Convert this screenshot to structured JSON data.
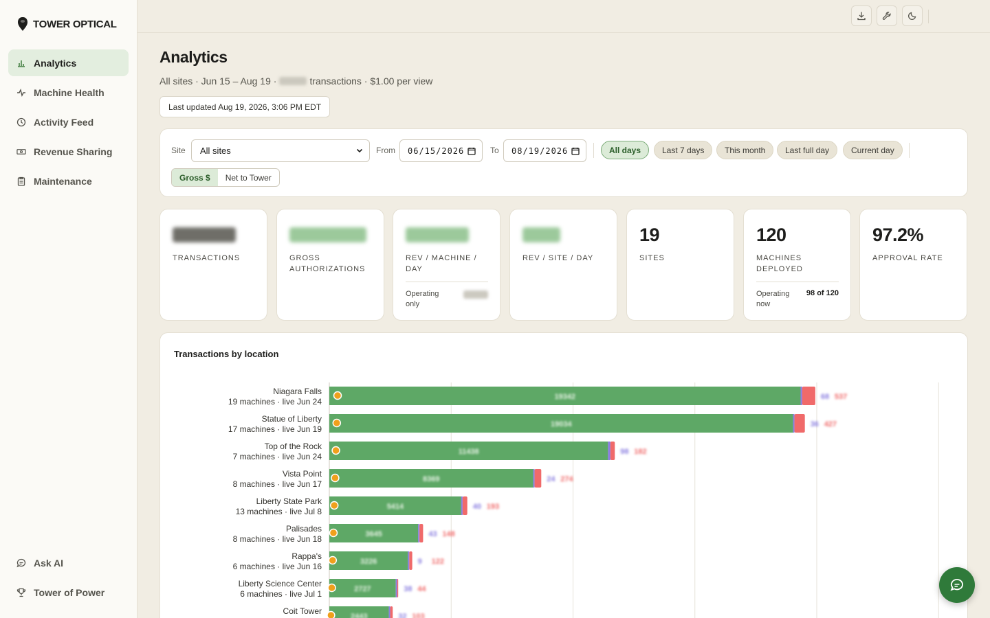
{
  "brand": {
    "name": "TOWER OPTICAL"
  },
  "nav": {
    "items": [
      {
        "label": "Analytics",
        "icon": "bar-chart-icon"
      },
      {
        "label": "Machine Health",
        "icon": "pulse-icon"
      },
      {
        "label": "Activity Feed",
        "icon": "clock-icon"
      },
      {
        "label": "Revenue Sharing",
        "icon": "cash-icon"
      },
      {
        "label": "Maintenance",
        "icon": "clipboard-icon"
      }
    ],
    "bottom": [
      {
        "label": "Ask AI",
        "icon": "chat-icon"
      },
      {
        "label": "Tower of Power",
        "icon": "trophy-icon"
      }
    ]
  },
  "header": {
    "title": "Analytics",
    "subtitle_prefix": "All sites · Jun 15 – Aug 19 ·",
    "subtitle_suffix": "transactions · $1.00 per view",
    "last_updated": "Last updated Aug 19, 2026, 3:06 PM EDT"
  },
  "filters": {
    "site_label": "Site",
    "site_value": "All sites",
    "from_label": "From",
    "from_value": "06/15/2026",
    "to_label": "To",
    "to_value": "08/19/2026",
    "ranges": [
      "All days",
      "Last 7 days",
      "This month",
      "Last full day",
      "Current day"
    ],
    "active_range": "All days",
    "mode_gross": "Gross $",
    "mode_net": "Net to Tower"
  },
  "kpis": {
    "transactions": {
      "label": "TRANSACTIONS"
    },
    "gross": {
      "label": "GROSS AUTHORIZATIONS"
    },
    "rev_machine": {
      "label": "REV / MACHINE / DAY",
      "sub_label": "Operating only"
    },
    "rev_site": {
      "label": "REV / SITE / DAY"
    },
    "sites": {
      "value": "19",
      "label": "SITES"
    },
    "machines": {
      "value": "120",
      "label": "MACHINES DEPLOYED",
      "sub_label": "Operating now",
      "sub_value": "98 of 120"
    },
    "approval": {
      "value": "97.2%",
      "label": "APPROVAL RATE"
    }
  },
  "colors": {
    "accent": "#2f7a3a",
    "bar_green": "#5ea866",
    "bar_purple": "#8a7ee0",
    "bar_red": "#f06a6a",
    "marker": "#f0a01c"
  },
  "chart_data": {
    "type": "bar",
    "title": "Transactions by location",
    "orientation": "horizontal",
    "stacked": true,
    "categories": [
      "Niagara Falls",
      "Statue of Liberty",
      "Top of the Rock",
      "Vista Point",
      "Liberty State Park",
      "Palisades",
      "Rappa's",
      "Liberty Science Center",
      "Coit Tower"
    ],
    "details": [
      "19 machines · live Jun 24",
      "17 machines · live Jun 19",
      "7 machines · live Jun 24",
      "8 machines · live Jun 17",
      "13 machines · live Jul 8",
      "8 machines · live Jun 18",
      "6 machines · live Jun 16",
      "6 machines · live Jul 1",
      ""
    ],
    "series": [
      {
        "name": "green",
        "values": [
          19342,
          19034,
          11438,
          8369,
          5414,
          3645,
          3226,
          2727,
          2443
        ]
      },
      {
        "name": "purple",
        "values": [
          68,
          36,
          98,
          24,
          40,
          43,
          9,
          38,
          32
        ]
      },
      {
        "name": "red",
        "values": [
          537,
          427,
          182,
          274,
          193,
          148,
          122,
          44,
          103
        ]
      }
    ],
    "xlim": [
      0,
      25000
    ],
    "grid": true
  }
}
